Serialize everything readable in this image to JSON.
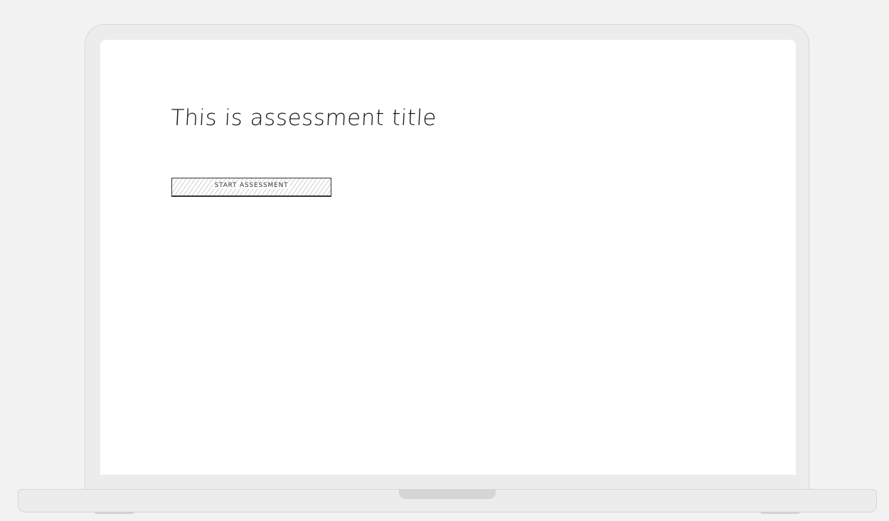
{
  "page": {
    "title": "This is assessment title",
    "start_button_label": "START ASSESSMENT"
  },
  "colors": {
    "background": "#f2f2f2",
    "bezel": "#ececec",
    "screen": "#ffffff",
    "text": "#1a1a1a"
  }
}
